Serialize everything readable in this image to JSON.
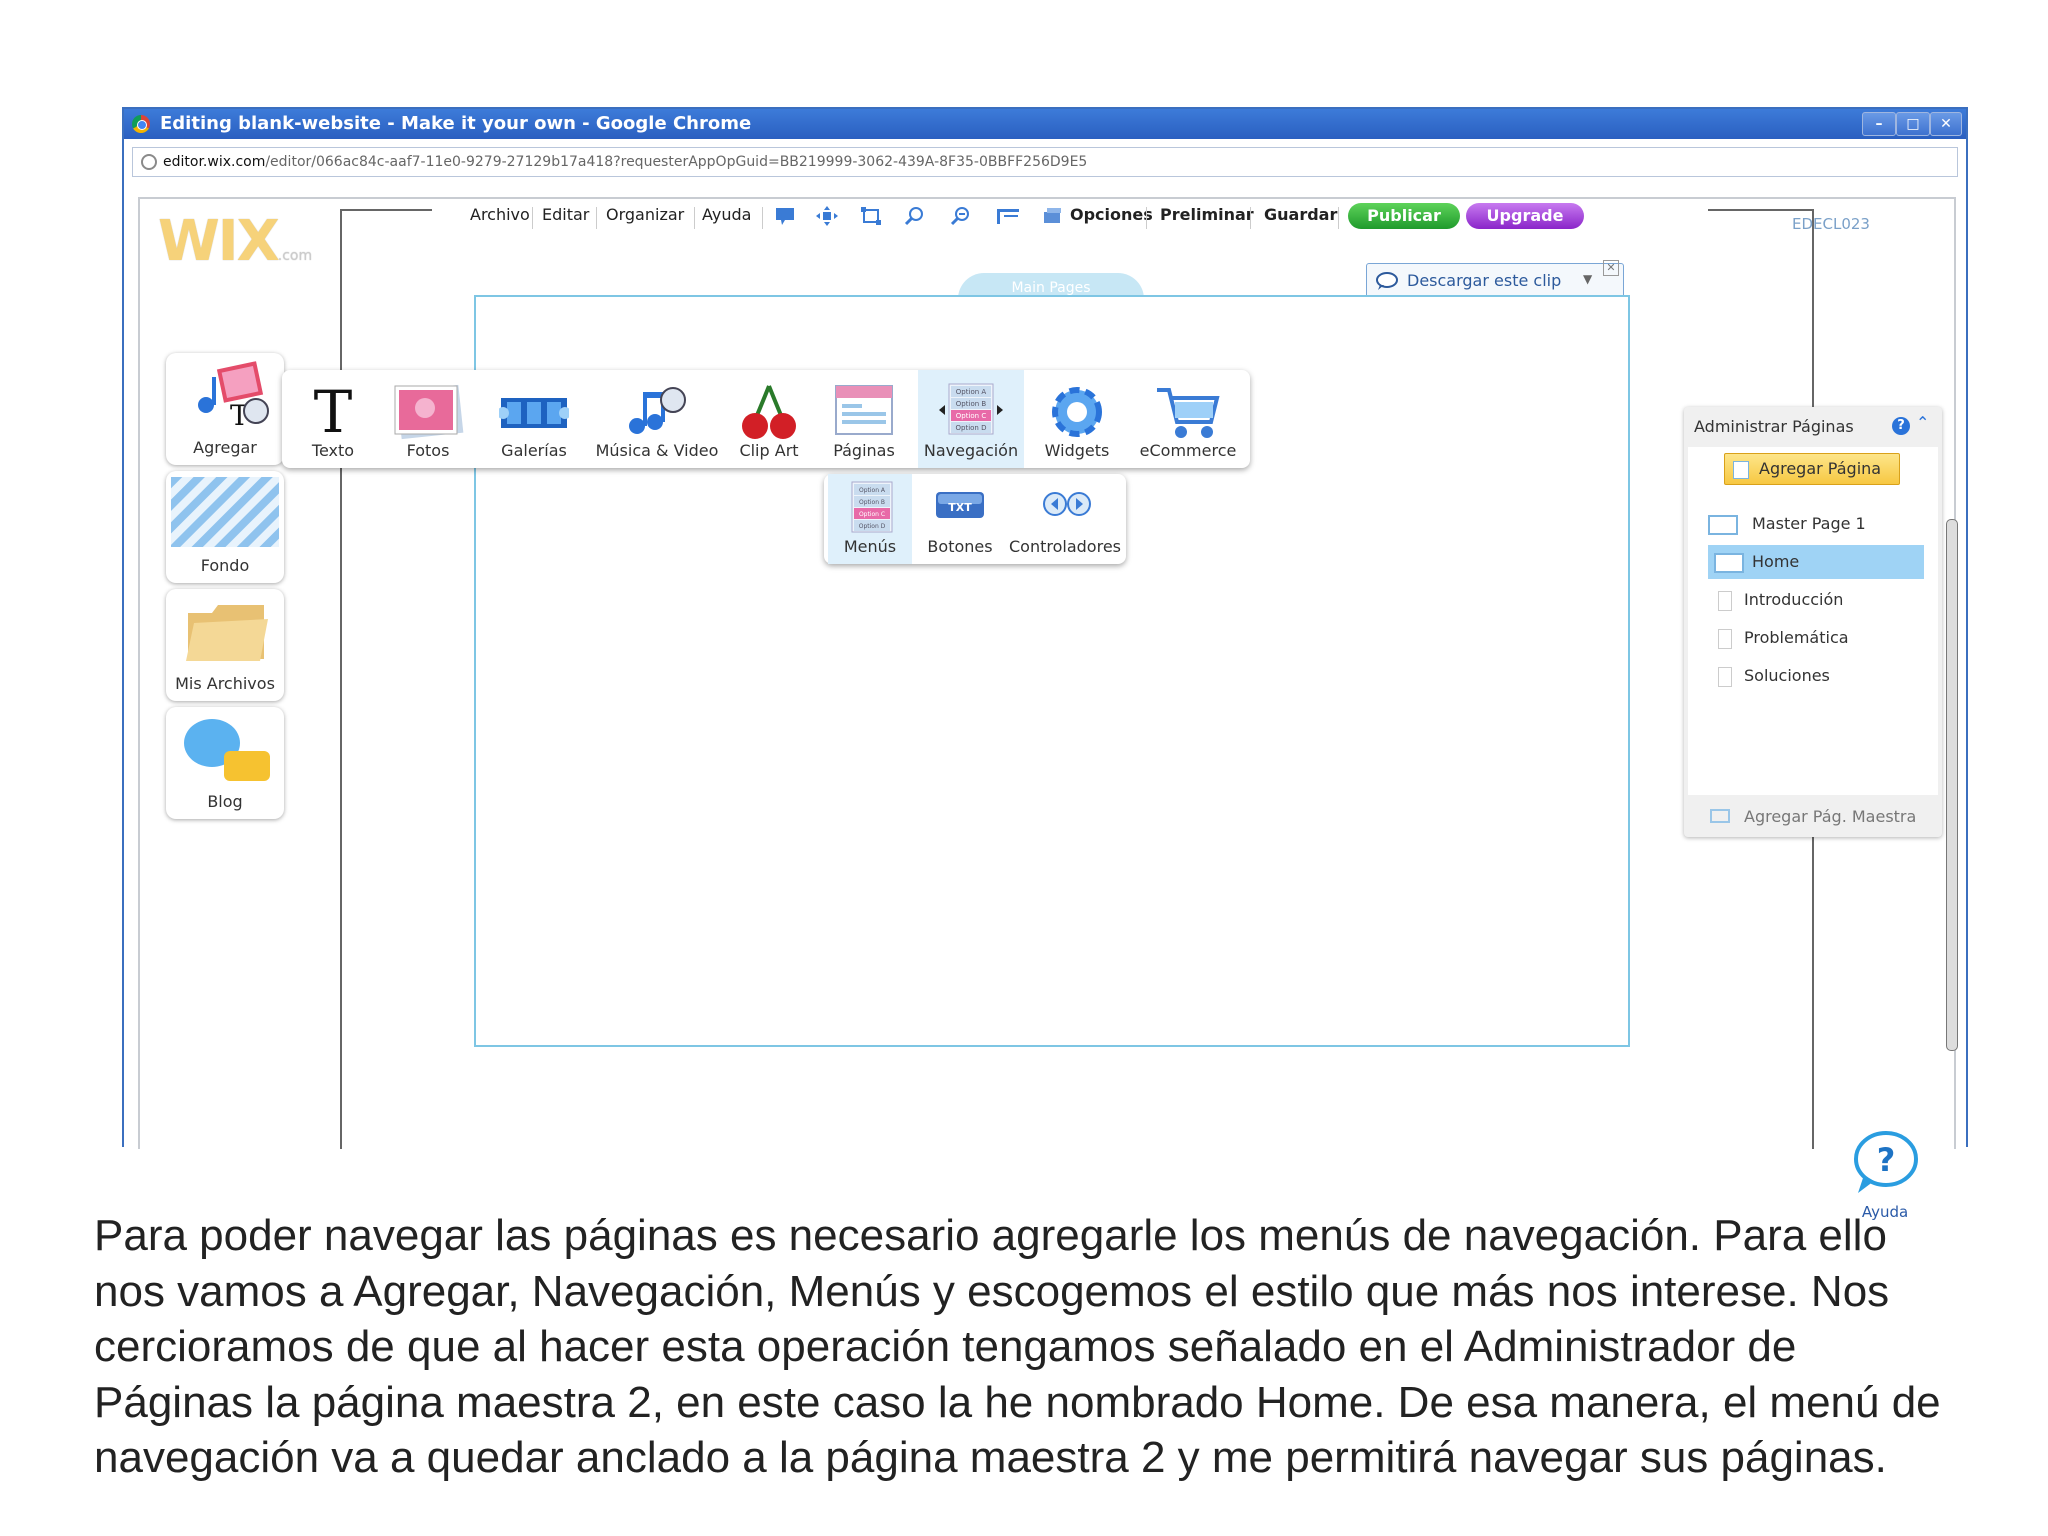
{
  "window": {
    "title": "Editing blank-website - Make it your own - Google Chrome",
    "controls": [
      "–",
      "□",
      "✕"
    ],
    "url_domain": "editor.wix.com",
    "url_path": "/editor/066ac84c-aaf7-11e0-9279-27129b17a418?requesterAppOpGuid=BB219999-3062-439A-8F35-0BBFF256D9E5"
  },
  "editor": {
    "logo": "WIX",
    "logo_suffix": ".com",
    "user_code": "EDECL023",
    "menu": [
      "Archivo",
      "Editar",
      "Organizar",
      "Ayuda"
    ],
    "toolbar_icons": [
      "comment-icon",
      "move-icon",
      "resize-icon",
      "zoom-out-icon",
      "zoom-in-icon",
      "ruler-icon",
      "settings-icon"
    ],
    "options_label": "Opciones",
    "preview_label": "Preliminar",
    "save_label": "Guardar",
    "publish_label": "Publicar",
    "upgrade_label": "Upgrade",
    "download_clip_label": "Descargar este clip",
    "main_pages_tab": "Main Pages"
  },
  "left_panel": {
    "items": [
      {
        "label": "Agregar"
      },
      {
        "label": "Fondo"
      },
      {
        "label": "Mis Archivos"
      },
      {
        "label": "Blog"
      }
    ]
  },
  "add_menu": {
    "items": [
      {
        "label": "Texto"
      },
      {
        "label": "Fotos"
      },
      {
        "label": "Galerías"
      },
      {
        "label": "Música & Video"
      },
      {
        "label": "Clip Art"
      },
      {
        "label": "Páginas"
      },
      {
        "label": "Navegación"
      },
      {
        "label": "Widgets"
      },
      {
        "label": "eCommerce"
      }
    ],
    "nav_icon_lines": [
      "Option A",
      "Option B",
      "Option C",
      "Option D"
    ]
  },
  "sub_menu": {
    "items": [
      {
        "label": "Menús"
      },
      {
        "label": "Botones"
      },
      {
        "label": "Controladores"
      }
    ],
    "button_icon_text": "TXT"
  },
  "pages_panel": {
    "title": "Administrar Páginas",
    "add_page_label": "Agregar Página",
    "pages": [
      {
        "label": "Master Page 1"
      },
      {
        "label": "Home"
      },
      {
        "label": "Introducción"
      },
      {
        "label": "Problemática"
      },
      {
        "label": "Soluciones"
      }
    ],
    "add_master_label": "Agregar Pág. Maestra"
  },
  "help": {
    "label": "Ayuda"
  },
  "caption": {
    "lines": [
      "Para poder navegar las páginas es necesario agregarle los menús de navegación. Para ello",
      "nos vamos a Agregar, Navegación, Menús y escogemos  el estilo que más nos interese. Nos",
      "cercioramos de que al hacer esta operación tengamos señalado en el Administrador de",
      "Páginas la página maestra 2, en este caso la he nombrado Home. De esa manera, el menú de",
      "navegación va a quedar anclado a la página maestra 2 y me permitirá navegar sus páginas."
    ]
  },
  "colors": {
    "titlebar": "#2f66c8",
    "publish": "#2ea83a",
    "upgrade": "#a23bd8",
    "selection": "#9fd3f5",
    "canvas_border": "#7ec6e4"
  }
}
